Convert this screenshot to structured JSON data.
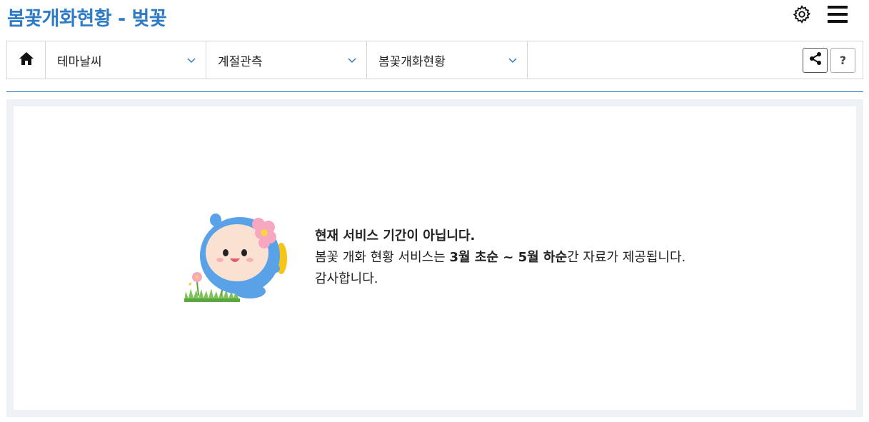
{
  "header": {
    "title": "봄꽃개화현황 - 벚꽃",
    "settings_icon": "gear-icon",
    "menu_icon": "hamburger-menu-icon"
  },
  "nav": {
    "home_icon": "home-icon",
    "dropdowns": [
      {
        "label": "테마날씨"
      },
      {
        "label": "계절관측"
      },
      {
        "label": "봄꽃개화현황"
      }
    ],
    "share_icon": "share-icon",
    "help_label": "?"
  },
  "notice": {
    "heading": "현재 서비스 기간이 아닙니다.",
    "line2_prefix": "봄꽃 개화 현황 서비스는 ",
    "line2_period": "3월 초순 ~ 5월 하순",
    "line2_suffix": "간 자료가 제공됩니다.",
    "line3": "감사합니다."
  },
  "colors": {
    "accent": "#2f7bc4",
    "content_bg": "#eef1f6"
  }
}
